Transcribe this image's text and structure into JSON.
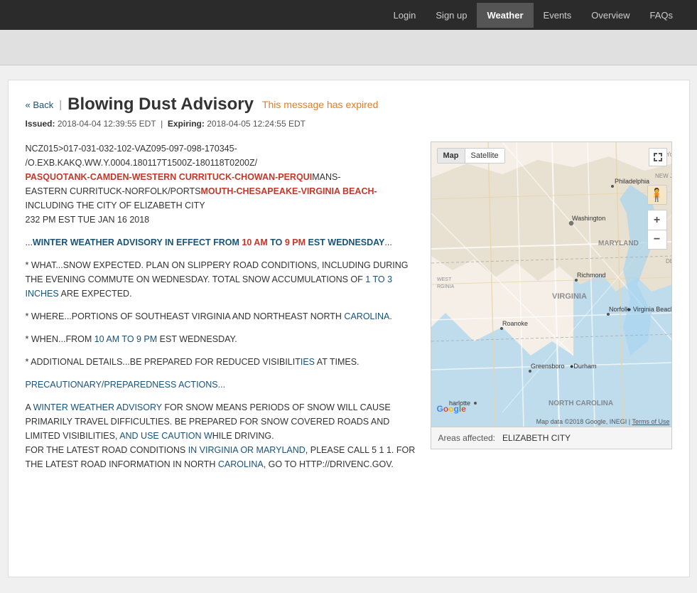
{
  "navbar": {
    "links": [
      {
        "id": "login",
        "label": "Login",
        "active": false
      },
      {
        "id": "signup",
        "label": "Sign up",
        "active": false
      },
      {
        "id": "weather",
        "label": "Weather",
        "active": true
      },
      {
        "id": "events",
        "label": "Events",
        "active": false
      },
      {
        "id": "overview",
        "label": "Overview",
        "active": false
      },
      {
        "id": "faqs",
        "label": "FAQs",
        "active": false
      }
    ]
  },
  "page": {
    "back_label": "« Back",
    "title": "Blowing Dust Advisory",
    "expired_label": "This message has expired",
    "issued_label": "Issued:",
    "issued_value": "2018-04-04 12:39:55 EDT",
    "expiring_label": "Expiring:",
    "expiring_value": "2018-04-05 12:24:55 EDT"
  },
  "advisory": {
    "code_block": "NCZ015>017-031-032-102-VAZ095-097-098-170345-\n/O.EXB.KAKQ.WW.Y.0004.180117T1500Z-180118T0200Z/\nPASQUOTANK-CAMDEN-WESTERN CURRITUCK-CHOWAN-PERQUIMANS-\nEASTERN CURRITUCK-NORFOLK/PORTSMOUTH-CHESAPEAKE-VIRGINIA BEACH-\nINCLUDING THE CITY OF ELIZABETH CITY\n232 PM EST TUE JAN 16 2018",
    "para1": "...WINTER WEATHER ADVISORY IN EFFECT FROM 10 AM TO 9 PM EST WEDNESDAY...",
    "para2": "* WHAT...SNOW EXPECTED. PLAN ON SLIPPERY ROAD CONDITIONS, INCLUDING DURING THE EVENING COMMUTE ON WEDNESDAY. TOTAL SNOW ACCUMULATIONS OF 1 TO 3 INCHES ARE EXPECTED.",
    "para3": "* WHERE...PORTIONS OF SOUTHEAST VIRGINIA AND NORTHEAST NORTH CAROLINA.",
    "para4": "* WHEN...FROM 10 AM TO 9 PM EST WEDNESDAY.",
    "para5": "* ADDITIONAL DETAILS...BE PREPARED FOR REDUCED VISIBILITIES AT TIMES.",
    "precautionary_link": "PRECAUTIONARY/PREPAREDNESS ACTIONS...",
    "para6": "A WINTER WEATHER ADVISORY FOR SNOW MEANS PERIODS OF SNOW WILL CAUSE PRIMARILY TRAVEL DIFFICULTIES. BE PREPARED FOR SNOW COVERED ROADS AND LIMITED VISIBILITIES, AND USE CAUTION WHILE DRIVING. FOR THE LATEST ROAD CONDITIONS IN VIRGINIA OR MARYLAND, PLEASE CALL 5 1 1. FOR THE LATEST ROAD INFORMATION IN NORTH CAROLINA, GO TO HTTP://DRIVENC.GOV."
  },
  "map": {
    "map_btn": "Map",
    "satellite_btn": "Satellite",
    "zoom_in": "+",
    "zoom_out": "−",
    "areas_affected_label": "Areas affected:",
    "areas_affected_value": "ELIZABETH CITY",
    "map_data_text": "Map data ©2018 Google, INEGI",
    "terms_text": "Terms of Use"
  }
}
